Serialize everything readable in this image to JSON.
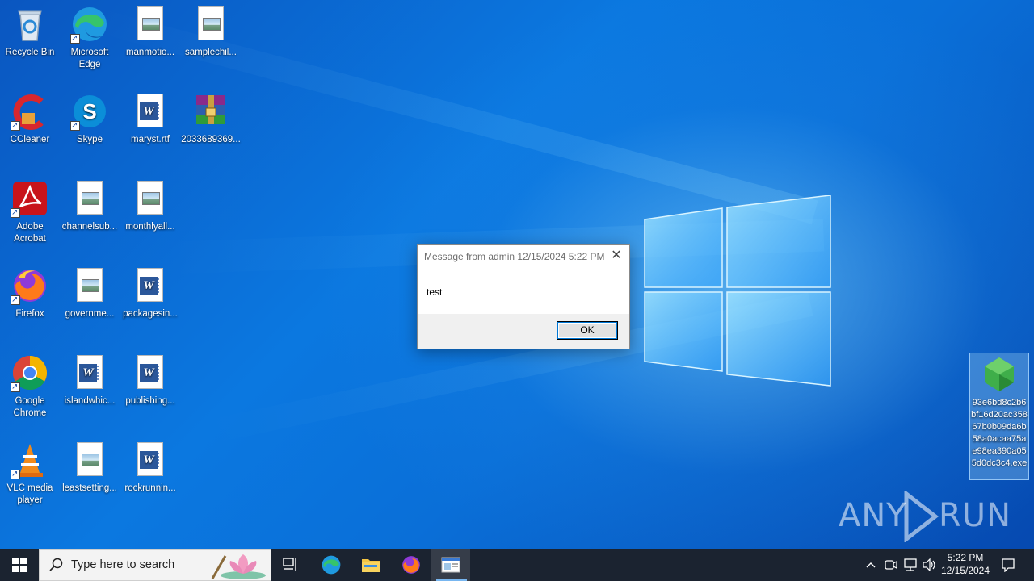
{
  "desktop": {
    "icons": [
      {
        "label": "Recycle Bin",
        "icon": "recycle-bin-icon"
      },
      {
        "label": "Microsoft Edge",
        "icon": "edge-icon"
      },
      {
        "label": "manmotio...",
        "icon": "image-file-icon"
      },
      {
        "label": "samplechil...",
        "icon": "image-file-icon"
      },
      {
        "label": "CCleaner",
        "icon": "ccleaner-icon"
      },
      {
        "label": "Skype",
        "icon": "skype-icon"
      },
      {
        "label": "maryst.rtf",
        "icon": "word-file-icon"
      },
      {
        "label": "2033689369...",
        "icon": "winrar-archive-icon"
      },
      {
        "label": "Adobe Acrobat",
        "icon": "acrobat-icon"
      },
      {
        "label": "channelsub...",
        "icon": "image-file-icon"
      },
      {
        "label": "monthlyall...",
        "icon": "image-file-icon"
      },
      {
        "label": "Firefox",
        "icon": "firefox-icon"
      },
      {
        "label": "governme...",
        "icon": "image-file-icon"
      },
      {
        "label": "packagesin...",
        "icon": "word-file-icon"
      },
      {
        "label": "Google Chrome",
        "icon": "chrome-icon"
      },
      {
        "label": "islandwhic...",
        "icon": "word-file-icon"
      },
      {
        "label": "publishing...",
        "icon": "word-file-icon"
      },
      {
        "label": "VLC media player",
        "icon": "vlc-icon"
      },
      {
        "label": "leastsetting...",
        "icon": "image-file-icon"
      },
      {
        "label": "rockrunnin...",
        "icon": "word-file-icon"
      }
    ],
    "selected_file": {
      "label": "93e6bd8c2b6bf16d20ac35867b0b09da6b58a0acaa75ae98ea390a055d0dc3c4.exe",
      "icon": "green-gem-exe-icon"
    }
  },
  "dialog": {
    "title": "Message from admin 12/15/2024 5:22 PM",
    "message": "test",
    "ok_label": "OK"
  },
  "watermark": {
    "left": "ANY",
    "right": "RUN"
  },
  "taskbar": {
    "search_placeholder": "Type here to search",
    "apps": [
      "task-view-icon",
      "edge-icon",
      "file-explorer-icon",
      "firefox-icon",
      "message-window-icon"
    ],
    "clock_time": "5:22 PM",
    "clock_date": "12/15/2024",
    "tray_chevron": "^"
  }
}
